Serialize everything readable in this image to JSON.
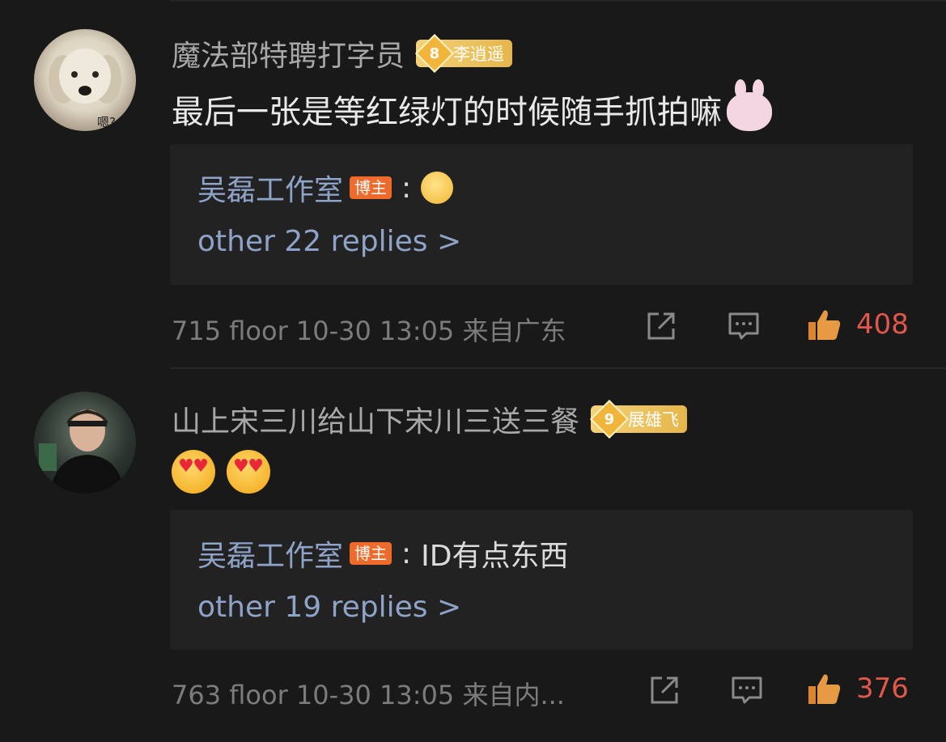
{
  "colors": {
    "background": "#191919",
    "reply_box": "#222222",
    "link_blue": "#8fa2c8",
    "like_red": "#e0584a",
    "blogger_badge": "#ef6b2c",
    "fan_badge_gold": "#e6b64a"
  },
  "comments": [
    {
      "avatar_caption": "嗯?",
      "username": "魔法部特聘打字员",
      "fan_badge": {
        "level": "8",
        "name": "李逍遥"
      },
      "text": "最后一张是等红绿灯的时候随手抓拍嘛",
      "emoji": "bunny-smile",
      "reply": {
        "author": "吴磊工作室",
        "badge": "博主",
        "separator": ":",
        "text": "",
        "emoji": "shush-face",
        "more": "other 22 replies >"
      },
      "meta": "715 floor 10-30 13:05 来自广东",
      "likes": "408"
    },
    {
      "avatar_caption": "",
      "username": "山上宋三川给山下宋川三送三餐",
      "fan_badge": {
        "level": "9",
        "name": "展雄飞"
      },
      "text": "",
      "emoji": "heart-eyes-tongue",
      "reply": {
        "author": "吴磊工作室",
        "badge": "博主",
        "separator": ":",
        "text": "ID有点东西",
        "emoji": "",
        "more": "other 19 replies >"
      },
      "meta": "763 floor 10-30 13:05 来自内...",
      "likes": "376"
    }
  ],
  "icons": {
    "share": "share-icon",
    "comment": "comment-icon",
    "like": "thumbs-up-icon"
  }
}
